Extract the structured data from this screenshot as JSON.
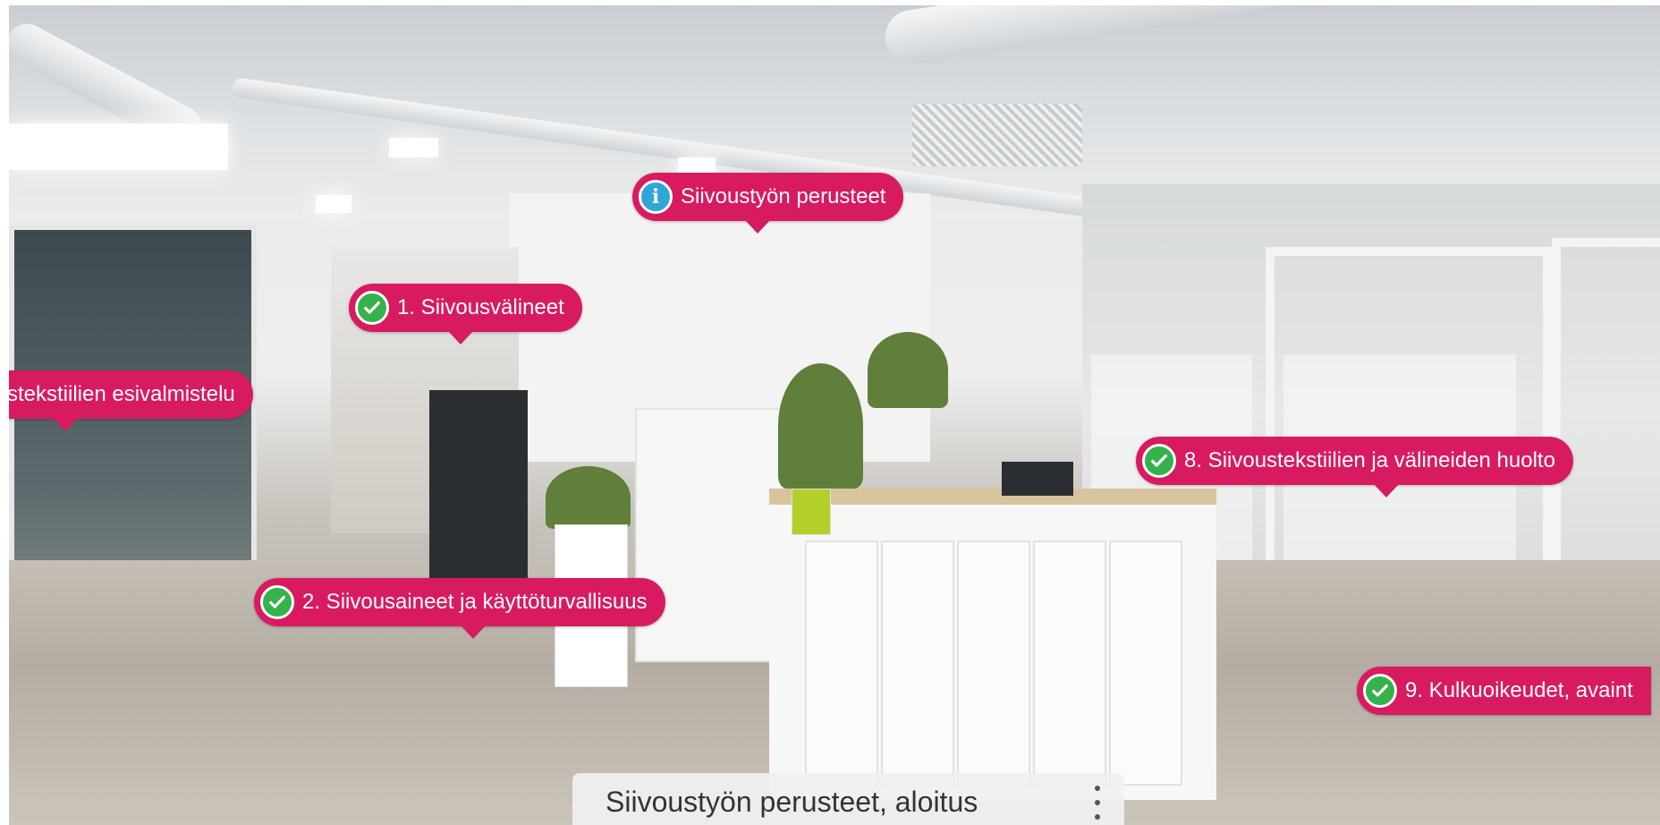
{
  "viewer": {
    "scene_title": "Siivoustyön perusteet, aloitus"
  },
  "hotspots": [
    {
      "label": "Siivoustyön perusteet",
      "icon": "info-icon"
    },
    {
      "label": "1. Siivousvälineet",
      "icon": "check-icon"
    },
    {
      "label": "stekstiilien esivalmistelu",
      "icon": "none"
    },
    {
      "label": "2. Siivousaineet ja käyttöturvallisuus",
      "icon": "check-icon"
    },
    {
      "label": "8. Siivoustekstiilien ja välineiden huolto",
      "icon": "check-icon"
    },
    {
      "label": "9. Kulkuoikeudet, avaint",
      "icon": "check-icon"
    }
  ],
  "colors": {
    "hotspot_bg": "#d81b60",
    "check_green": "#35b24a",
    "info_blue": "#2fa7d6"
  }
}
